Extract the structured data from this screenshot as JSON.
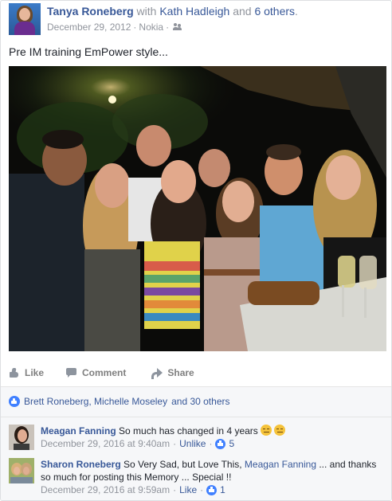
{
  "post": {
    "author": "Tanya Roneberg",
    "with_text": "with",
    "tagged_first": "Kath Hadleigh",
    "and_text": "and",
    "tagged_others": "6 others",
    "date": "December 29, 2012",
    "separator": "·",
    "device": "Nokia",
    "audience_icon": "friends-icon",
    "text": "Pre IM training EmPower style..."
  },
  "actions": {
    "like": "Like",
    "comment": "Comment",
    "share": "Share"
  },
  "reactions": {
    "names": "Brett Roneberg, Michelle Moseley",
    "and_text": "and 30 others"
  },
  "comments": [
    {
      "author": "Meagan Fanning",
      "text": "So much has changed in 4 years",
      "emojis": 2,
      "date": "December 29, 2016 at 9:40am",
      "sep": "·",
      "action": "Unlike",
      "sep2": "·",
      "likes": "5"
    },
    {
      "author": "Sharon Roneberg",
      "text_before": "So Very Sad, but Love This,",
      "mention": "Meagan Fanning",
      "text_after": "... and thanks so much for posting this Memory ... Special !!",
      "date": "December 29, 2016 at 9:59am",
      "sep": "·",
      "action": "Like",
      "sep2": "·",
      "likes": "1"
    }
  ],
  "colors": {
    "link": "#385898",
    "muted": "#90949c",
    "like_blue": "#4080ff"
  }
}
